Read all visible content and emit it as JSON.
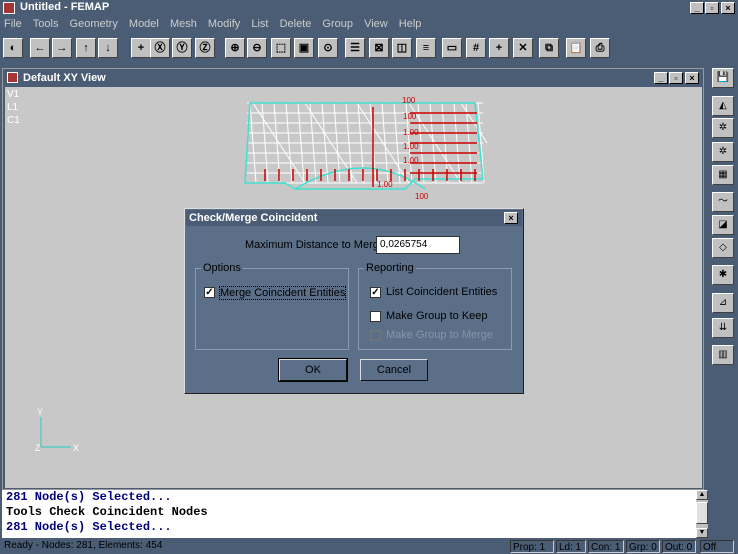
{
  "app": {
    "title": "Untitled - FEMAP",
    "controls": {
      "minimize": "_",
      "maximize": "▫",
      "close": "×"
    }
  },
  "menu": [
    "File",
    "Tools",
    "Geometry",
    "Model",
    "Mesh",
    "Modify",
    "List",
    "Delete",
    "Group",
    "View",
    "Help"
  ],
  "toolbar": {
    "icons": [
      "rotate-icon",
      "arrow-left-icon",
      "arrow-right-icon",
      "arrow-up-icon",
      "arrow-down-icon",
      "plus-icon",
      "rotate-x-icon",
      "rotate-y-icon",
      "rotate-z-icon",
      "zoom-in-icon",
      "zoom-out-icon",
      "zoom-box-icon",
      "autoscale-icon",
      "center-icon",
      "list-view-icon",
      "box-icon",
      "solid-icon",
      "layers-icon",
      "window-icon",
      "grid-icon",
      "crosshair-icon",
      "cross-icon",
      "copy-icon",
      "paste-icon",
      "print-icon"
    ],
    "glyphs": [
      "◐",
      "←",
      "→",
      "↑",
      "↓",
      "+",
      "Ⓧ",
      "Ⓨ",
      "Ⓩ",
      "⊕",
      "⊖",
      "⬚",
      "▣",
      "⊙",
      "☰",
      "⊠",
      "◫",
      "≡",
      "▭",
      "#",
      "+",
      "✕",
      "⧉",
      "📋",
      "⎙"
    ]
  },
  "right_toolbar": {
    "icons": [
      "save-icon",
      "geometry-icon",
      "nodes-icon",
      "elements-icon",
      "mesh-icon",
      "curve-icon",
      "surface-icon",
      "solid-icon",
      "load-icon",
      "constraint-icon",
      "arrow-down-icon",
      "group-icon"
    ],
    "glyphs": [
      "💾",
      "◭",
      "✲",
      "✲",
      "▦",
      "〜",
      "◪",
      "◇",
      "✱",
      "⊿",
      "⇊",
      "▥"
    ]
  },
  "view": {
    "title": "Default XY View",
    "info": [
      "V1",
      "L1",
      "C1"
    ],
    "axes": {
      "y": "Y",
      "x": "Z",
      "x2": "X"
    },
    "load_labels": [
      "100",
      "100",
      "1.00",
      "1.00",
      "1.00",
      "1.00",
      "100"
    ],
    "controls": {
      "minimize": "_",
      "maximize": "▫",
      "close": "×"
    }
  },
  "dialog": {
    "title": "Check/Merge Coincident",
    "close": "×",
    "max_distance_label": "Maximum Distance to Merge",
    "max_distance_value": "0,0265754",
    "options_label": "Options",
    "merge_label": "Merge Coincident Entities",
    "merge_checked": true,
    "reporting_label": "Reporting",
    "list_label": "List Coincident Entities",
    "list_checked": true,
    "make_group_keep_label": "Make Group to Keep",
    "make_group_keep_checked": false,
    "make_group_merge_label": "Make Group to Merge",
    "make_group_merge_checked": false,
    "ok_label": "OK",
    "cancel_label": "Cancel"
  },
  "console": {
    "lines": [
      {
        "text": "281 Node(s) Selected...",
        "color": "#00007b"
      },
      {
        "text": "Tools Check Coincident Nodes",
        "color": "#000000"
      },
      {
        "text": "281 Node(s) Selected...",
        "color": "#00007b"
      }
    ]
  },
  "status": {
    "left": "Ready - Nodes: 281, Elements: 454",
    "prop": "Prop: 1",
    "ld": "Ld: 1",
    "con": "Con: 1",
    "grp": "Grp: 0",
    "out": "Out: 0",
    "off": "Off"
  },
  "colors": {
    "frame": "#4b5d75",
    "dialog": "#5c6f88",
    "viewport": "#c8c8c8",
    "mesh": "#ffffff",
    "mesh_edge": "#40e0d0",
    "load": "#cc0000"
  }
}
